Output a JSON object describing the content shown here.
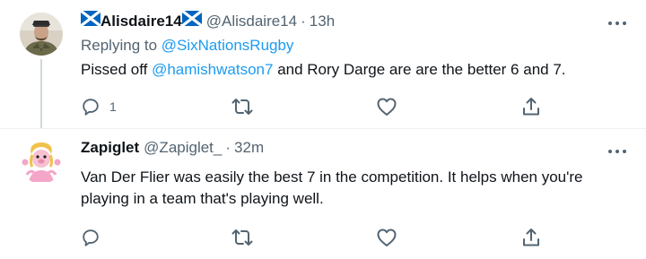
{
  "tweets": [
    {
      "display_name": "Alisdaire14",
      "handle": "@Alisdaire14",
      "separator": "·",
      "time": "13h",
      "replying_prefix": "Replying to ",
      "replying_to": "@SixNationsRugby",
      "text_mention": "@hamishwatson7",
      "text_before": "Pissed off ",
      "text_after": " and Rory Darge are are the better 6 and 7.",
      "reply_count": "1",
      "icons": [
        "scotland-flag-icon",
        "reply-icon",
        "retweet-icon",
        "like-icon",
        "share-icon",
        "more-icon"
      ]
    },
    {
      "display_name": "Zapiglet",
      "handle": "@Zapiglet_",
      "separator": "·",
      "time": "32m",
      "text": "Van Der Flier was easily the best 7 in the competition. It helps when you're playing in a team that's playing well.",
      "reply_count": "",
      "icons": [
        "reply-icon",
        "retweet-icon",
        "like-icon",
        "share-icon",
        "more-icon"
      ]
    }
  ],
  "colors": {
    "text": "#0f1419",
    "secondary": "#536471",
    "link": "#1d9bf0",
    "divider": "#eff3f4",
    "thread_line": "#cfd9de",
    "flag_blue": "#0065bd"
  }
}
